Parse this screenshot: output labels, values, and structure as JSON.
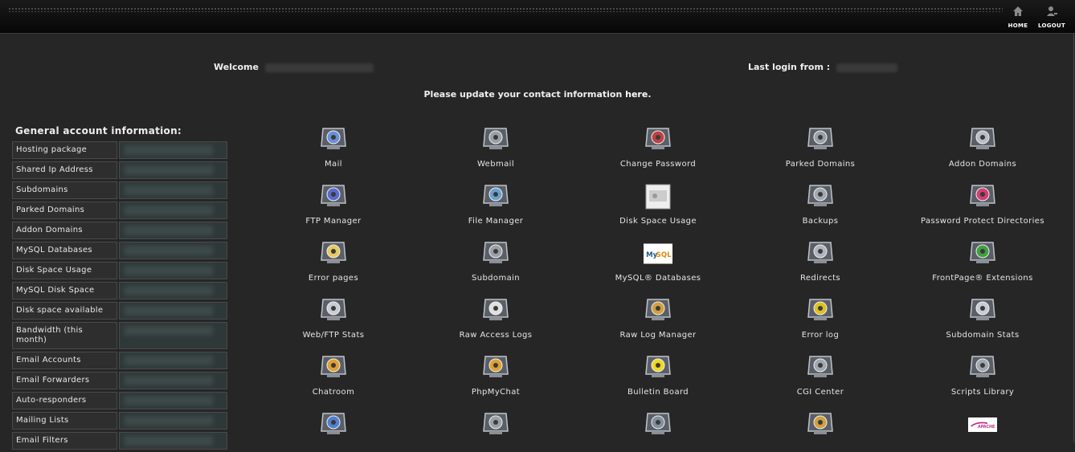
{
  "header": {
    "home_label": "HOME",
    "logout_label": "LOGOUT"
  },
  "welcome": {
    "welcome_label": "Welcome",
    "last_login_label": "Last login from :"
  },
  "notice": {
    "text_before": "Please update your contact information ",
    "link_text": "here",
    "text_after": "."
  },
  "account_info": {
    "title": "General account information:",
    "rows": [
      "Hosting package",
      "Shared Ip Address",
      "Subdomains",
      "Parked Domains",
      "Addon Domains",
      "MySQL Databases",
      "Disk Space Usage",
      "MySQL Disk Space",
      "Disk space available",
      "Bandwidth (this month)",
      "Email Accounts",
      "Email Forwarders",
      "Auto-responders",
      "Mailing Lists",
      "Email Filters"
    ]
  },
  "icons": [
    {
      "label": "Mail",
      "icon": "mail-icon",
      "color": "#6a8fd8"
    },
    {
      "label": "Webmail",
      "icon": "webmail-icon",
      "color": "#9aa0a8"
    },
    {
      "label": "Change Password",
      "icon": "change-password-icon",
      "color": "#c04040"
    },
    {
      "label": "Parked Domains",
      "icon": "parked-domains-icon",
      "color": "#9aa0a8"
    },
    {
      "label": "Addon Domains",
      "icon": "addon-domains-icon",
      "color": "#b8bcc4"
    },
    {
      "label": "FTP Manager",
      "icon": "ftp-manager-icon",
      "color": "#5a6ad0"
    },
    {
      "label": "File Manager",
      "icon": "file-manager-icon",
      "color": "#6aa0d0"
    },
    {
      "label": "Disk Space Usage",
      "icon": "disk-space-icon",
      "color": "#d8d8d8"
    },
    {
      "label": "Backups",
      "icon": "backups-icon",
      "color": "#a0a8b0"
    },
    {
      "label": "Password Protect Directories",
      "icon": "password-protect-icon",
      "color": "#d04070"
    },
    {
      "label": "Error pages",
      "icon": "error-pages-icon",
      "color": "#e8c860"
    },
    {
      "label": "Subdomain",
      "icon": "subdomain-icon",
      "color": "#9aa0a8"
    },
    {
      "label": "MySQL® Databases",
      "icon": "mysql-logo",
      "color": "#2a6a9a"
    },
    {
      "label": "Redirects",
      "icon": "redirects-icon",
      "color": "#b0b4bc"
    },
    {
      "label": "FrontPage® Extensions",
      "icon": "frontpage-icon",
      "color": "#40a040"
    },
    {
      "label": "Web/FTP Stats",
      "icon": "stats-icon",
      "color": "#c8ccd4"
    },
    {
      "label": "Raw Access Logs",
      "icon": "raw-logs-icon",
      "color": "#e0e0e0"
    },
    {
      "label": "Raw Log Manager",
      "icon": "raw-log-manager-icon",
      "color": "#d0a040"
    },
    {
      "label": "Error log",
      "icon": "error-log-icon",
      "color": "#e0c020"
    },
    {
      "label": "Subdomain Stats",
      "icon": "subdomain-stats-icon",
      "color": "#c8ccd4"
    },
    {
      "label": "Chatroom",
      "icon": "chatroom-icon",
      "color": "#e0a030"
    },
    {
      "label": "PhpMyChat",
      "icon": "phpmychat-icon",
      "color": "#e0a030"
    },
    {
      "label": "Bulletin Board",
      "icon": "bulletin-board-icon",
      "color": "#f0d820"
    },
    {
      "label": "CGI Center",
      "icon": "cgi-center-icon",
      "color": "#a0a8b0"
    },
    {
      "label": "Scripts Library",
      "icon": "scripts-library-icon",
      "color": "#a0a8b0"
    },
    {
      "label": "",
      "icon": "shopping-cart-icon",
      "color": "#5080d0"
    },
    {
      "label": "",
      "icon": "cron-jobs-icon",
      "color": "#9aa0a8"
    },
    {
      "label": "",
      "icon": "network-tools-icon",
      "color": "#8090a0"
    },
    {
      "label": "",
      "icon": "gear-tools-icon",
      "color": "#d0a040"
    },
    {
      "label": "",
      "icon": "apache-logo",
      "color": "#c0308a"
    }
  ]
}
